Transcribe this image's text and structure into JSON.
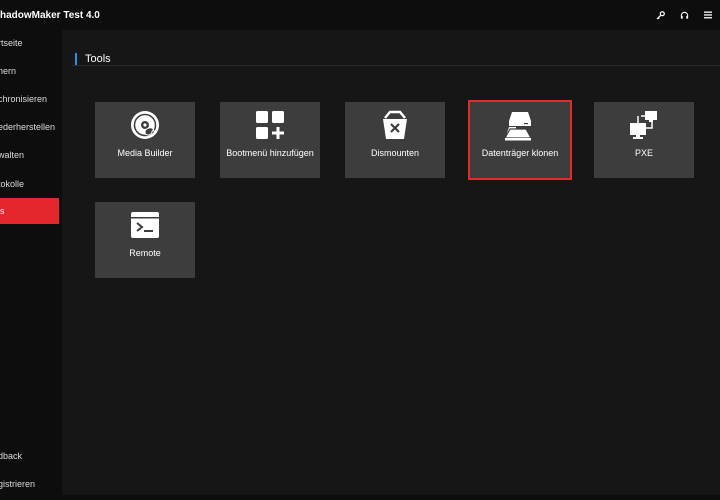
{
  "window": {
    "title": "hadowMaker Test 4.0",
    "controls": [
      "key-icon",
      "headset-icon",
      "menu-icon"
    ]
  },
  "sidebar": {
    "items": [
      {
        "label": "rtseite",
        "icon": "home-icon"
      },
      {
        "label": "hern",
        "icon": "backup-icon"
      },
      {
        "label": "chronisieren",
        "icon": "sync-icon"
      },
      {
        "label": "ederherstellen",
        "icon": "restore-icon"
      },
      {
        "label": "walten",
        "icon": "manage-icon"
      },
      {
        "label": "tokolle",
        "icon": "log-icon"
      },
      {
        "label": "ls",
        "icon": "tools-icon",
        "active": true
      }
    ],
    "bottom_items": [
      {
        "label": "dback"
      },
      {
        "label": "gistrieren"
      }
    ]
  },
  "main": {
    "section_title": "Tools",
    "tools": [
      {
        "label": "Media Builder",
        "icon": "media-builder-disc-icon"
      },
      {
        "label": "Bootmenü hinzufügen",
        "icon": "add-boot-menu-icon"
      },
      {
        "label": "Dismounten",
        "icon": "dismount-icon"
      },
      {
        "label": "Datenträger klonen",
        "icon": "clone-disk-icon",
        "selected": true
      },
      {
        "label": "PXE",
        "icon": "pxe-network-icon"
      },
      {
        "label": "Remote",
        "icon": "remote-console-icon"
      }
    ]
  },
  "colors": {
    "background": "#0d0d0d",
    "panel": "#161616",
    "tile": "#3d3d3d",
    "accent_blue": "#2f8fe0",
    "active_red": "#e4262d"
  }
}
